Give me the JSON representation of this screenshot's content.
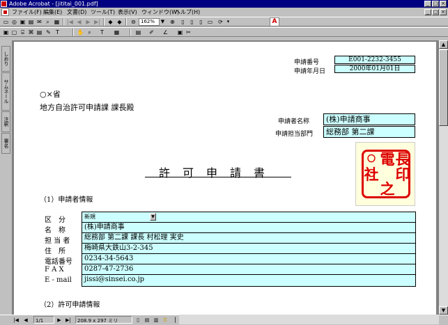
{
  "window": {
    "title": "Adobe Acrobat - [jititai_001.pdf]"
  },
  "menu": [
    "ファイル(F)",
    "編集(E)",
    "文書(D)",
    "ツール(T)",
    "表示(V)",
    "ウィンドウ(W)",
    "ヘルプ(H)"
  ],
  "toolbar": {
    "zoom_value": "162%"
  },
  "nav_tabs": [
    "しおり",
    "サムネール",
    "注釈",
    "署名"
  ],
  "status": {
    "page_indicator": "1/1",
    "page_size": "208.9 x 297 ミリ"
  },
  "document": {
    "app_number_label": "申請番号",
    "app_number_value": "E001-2232-3455",
    "app_date_label": "申請年月日",
    "app_date_value": "2000年01月01日",
    "ministry": "○×省",
    "addressee": "地方自治許可申請課 課長殿",
    "applicant_name_label": "申請者名称",
    "applicant_name_value": "(株)申請商事",
    "applicant_dept_label": "申請担当部門",
    "applicant_dept_value": "総務部 第二課",
    "seal_chars": [
      "電",
      "長",
      "印",
      "〇〇",
      "社",
      "之"
    ],
    "title": "許可申請書",
    "section1": "（1）申請者情報",
    "section2": "（2）許可申請情報",
    "fields": [
      {
        "label": "区　分",
        "value": "新規"
      },
      {
        "label": "名　称",
        "value": "(株)申請商事"
      },
      {
        "label": "担 当 者",
        "value": "総務部 第二課 課長 村松理 実史"
      },
      {
        "label": "住　所",
        "value": "梅崎県大鉄山3-2-345"
      },
      {
        "label": "電話番号",
        "value": "0234-34-5643"
      },
      {
        "label": "F A X",
        "value": "0287-47-2736"
      },
      {
        "label": "E - mail",
        "value": "jissi@sinsei.co.jp"
      }
    ]
  }
}
